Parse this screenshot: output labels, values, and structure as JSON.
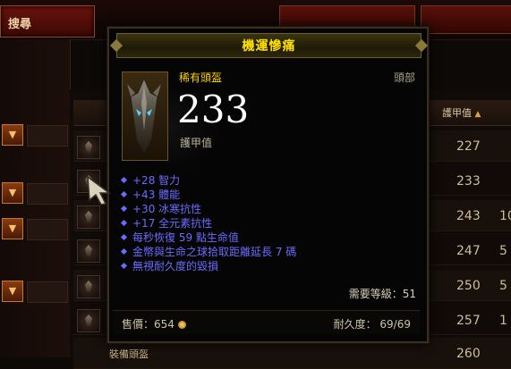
{
  "top_bar": {
    "search_tab": "搜尋"
  },
  "table": {
    "armor_header": "護甲值",
    "sort_arrow": "▲",
    "rows": [
      {
        "armor": "227",
        "extra": ""
      },
      {
        "armor": "233",
        "extra": ""
      },
      {
        "armor": "243",
        "extra": "10"
      },
      {
        "armor": "247",
        "extra": "5"
      },
      {
        "armor": "250",
        "extra": "5"
      },
      {
        "armor": "257",
        "extra": "1"
      },
      {
        "armor": "260",
        "extra": ""
      }
    ],
    "bottom_label": "裝備頭盔"
  },
  "tooltip": {
    "title": "機運慘痛",
    "item_type": "稀有頭盔",
    "slot": "頭部",
    "armor_value": "233",
    "armor_label": "護甲值",
    "affixes": [
      "+28 智力",
      "+43 體能",
      "+30 冰寒抗性",
      "+17 全元素抗性",
      "每秒恢復 59 點生命值",
      "金幣與生命之球拾取距離延長 7 碼",
      "無視耐久度的毀損"
    ],
    "required_level": "需要等級：51",
    "price": "售價：654",
    "durability": "耐久度：  69/69"
  },
  "colors": {
    "title": "#ffe100",
    "item_type": "#ffd400",
    "affix": "#6b6bff",
    "armor_value": "#ffffff"
  },
  "icons": [
    "helm-icon",
    "coin-icon",
    "cursor-icon",
    "dropdown-icon",
    "item-icon"
  ]
}
